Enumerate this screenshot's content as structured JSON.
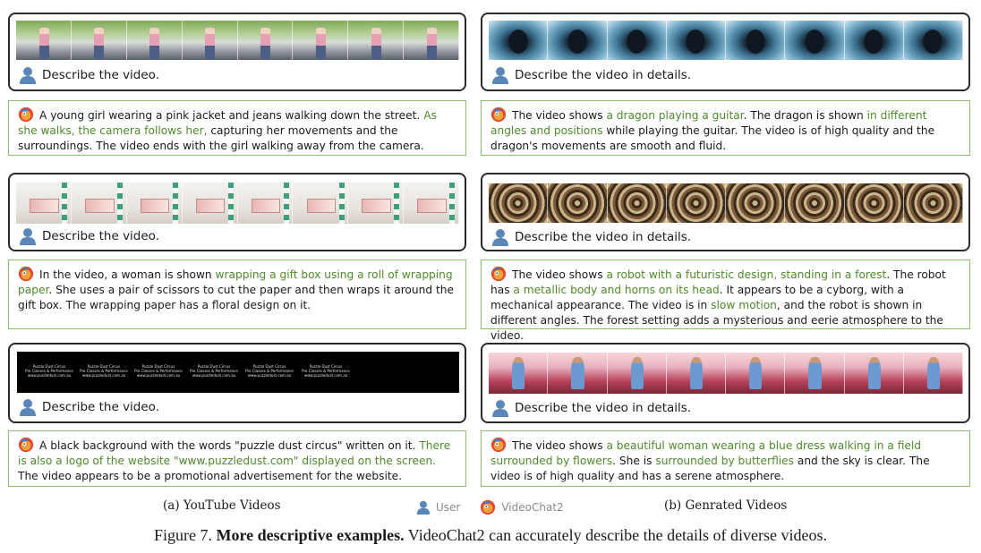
{
  "colors": {
    "highlight": "#4f8a2c",
    "answer_border": "#8bbf6e",
    "prompt_border": "#2a2a2a"
  },
  "panels": [
    {
      "prompt": "Describe the video.",
      "answer": [
        {
          "t": "A young girl wearing a pink jacket and jeans walking down the street. "
        },
        {
          "t": "As she walks, the camera follows her,",
          "h": true
        },
        {
          "t": " capturing her movements and the surroundings. The video ends with the girl walking away from the camera."
        }
      ]
    },
    {
      "prompt": "Describe the video.",
      "answer": [
        {
          "t": "In the video, a woman is shown "
        },
        {
          "t": "wrapping a gift box using a roll of wrapping paper",
          "h": true
        },
        {
          "t": ". She uses a pair of scissors to cut the paper and then wraps it around the gift box. The wrapping paper has a floral design on it."
        }
      ]
    },
    {
      "prompt": "Describe the video.",
      "video_text": [
        "Puzzle Dust Circus",
        "Pro Classes & Performance",
        "www.puzzledust.com.au"
      ],
      "answer": [
        {
          "t": "A black background with the words \"puzzle dust circus\" written on it. "
        },
        {
          "t": "There is also a logo of the website \"www.puzzledust.com\" displayed on the screen.",
          "h": true
        },
        {
          "t": " The video appears to be a promotional advertisement for the website."
        }
      ]
    },
    {
      "prompt": "Describe the video in details.",
      "answer": [
        {
          "t": "The video shows "
        },
        {
          "t": "a dragon playing a guitar",
          "h": true
        },
        {
          "t": ". The dragon is shown "
        },
        {
          "t": "in different angles and positions",
          "h": true
        },
        {
          "t": " while playing the guitar. The video is of high quality and the dragon's movements are smooth and fluid."
        }
      ]
    },
    {
      "prompt": "Describe the video in details.",
      "answer": [
        {
          "t": "The video shows "
        },
        {
          "t": "a robot with a futuristic design, standing in a forest",
          "h": true
        },
        {
          "t": ". The robot has "
        },
        {
          "t": "a metallic body and horns on its head",
          "h": true
        },
        {
          "t": ". It appears to be a cyborg, with a mechanical appearance. The video is in "
        },
        {
          "t": "slow motion",
          "h": true
        },
        {
          "t": ", and the robot is shown in different angles. The forest setting adds a mysterious and eerie atmosphere to the video."
        }
      ]
    },
    {
      "prompt": "Describe the video in details.",
      "answer": [
        {
          "t": "The video shows "
        },
        {
          "t": "a beautiful woman wearing a blue dress walking in a field surrounded by flowers",
          "h": true
        },
        {
          "t": ". She is "
        },
        {
          "t": "surrounded by butterflies",
          "h": true
        },
        {
          "t": " and the sky is clear. The video is of high quality and has a serene atmosphere."
        }
      ]
    }
  ],
  "subcaptions": {
    "left": "(a) YouTube Videos",
    "right": "(b) Genrated Videos"
  },
  "legend": {
    "user": "User",
    "bot": "VideoChat2"
  },
  "figure_caption": {
    "label": "Figure 7.",
    "bold": "More descriptive examples.",
    "rest": "VideoChat2 can accurately describe the details of diverse videos."
  }
}
